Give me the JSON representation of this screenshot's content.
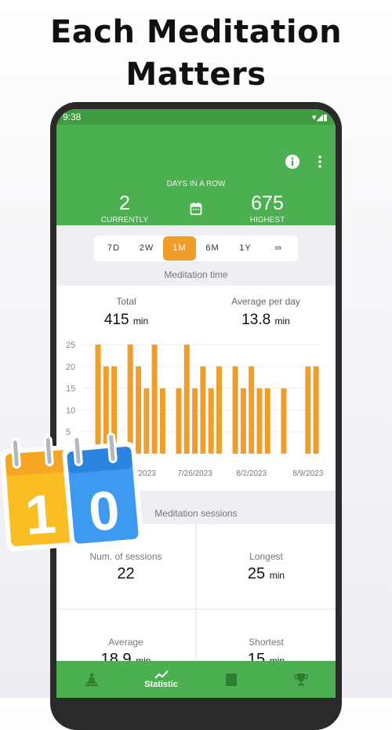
{
  "headline": {
    "line1": "Each Meditation",
    "line2": "Matters"
  },
  "status_bar": {
    "time": "9:38"
  },
  "streak": {
    "title": "DAYS IN A ROW",
    "current_value": "2",
    "current_label": "CURRENTLY",
    "highest_value": "675",
    "highest_label": "HIGHEST"
  },
  "periods": [
    {
      "label": "7D"
    },
    {
      "label": "2W"
    },
    {
      "label": "1M",
      "selected": true
    },
    {
      "label": "6M"
    },
    {
      "label": "1Y"
    },
    {
      "label": "∞"
    }
  ],
  "meditation_time": {
    "section_title": "Meditation time",
    "total_label": "Total",
    "total_value": "415",
    "total_unit": "min",
    "avg_label": "Average per day",
    "avg_value": "13.8",
    "avg_unit": "min"
  },
  "chart_data": {
    "type": "bar",
    "x_tick_labels": [
      "7/19/2023",
      "7/26/2023",
      "8/2/2023",
      "8/9/2023"
    ],
    "y_ticks": [
      5,
      10,
      15,
      20,
      25
    ],
    "ylim": [
      0,
      25
    ],
    "grid": true,
    "bar_color": "#f19d2a",
    "values": [
      25,
      20,
      20,
      0,
      25,
      20,
      15,
      25,
      15,
      0,
      15,
      25,
      15,
      20,
      15,
      20,
      0,
      20,
      15,
      20,
      15,
      15,
      0,
      15,
      0,
      0,
      20,
      20
    ]
  },
  "sessions": {
    "section_title": "Meditation sessions",
    "cells": [
      {
        "label": "Num. of sessions",
        "value": "22",
        "unit": ""
      },
      {
        "label": "Longest",
        "value": "25",
        "unit": "min"
      },
      {
        "label": "Average",
        "value": "18.9",
        "unit": "min"
      },
      {
        "label": "Shortest",
        "value": "15",
        "unit": "min"
      }
    ]
  },
  "bottom_nav": {
    "active_label": "Statistic"
  },
  "sticker": {
    "digit1": "1",
    "digit2": "0"
  },
  "colors": {
    "primary_green": "#4caf50",
    "accent_orange": "#f19d2a"
  }
}
